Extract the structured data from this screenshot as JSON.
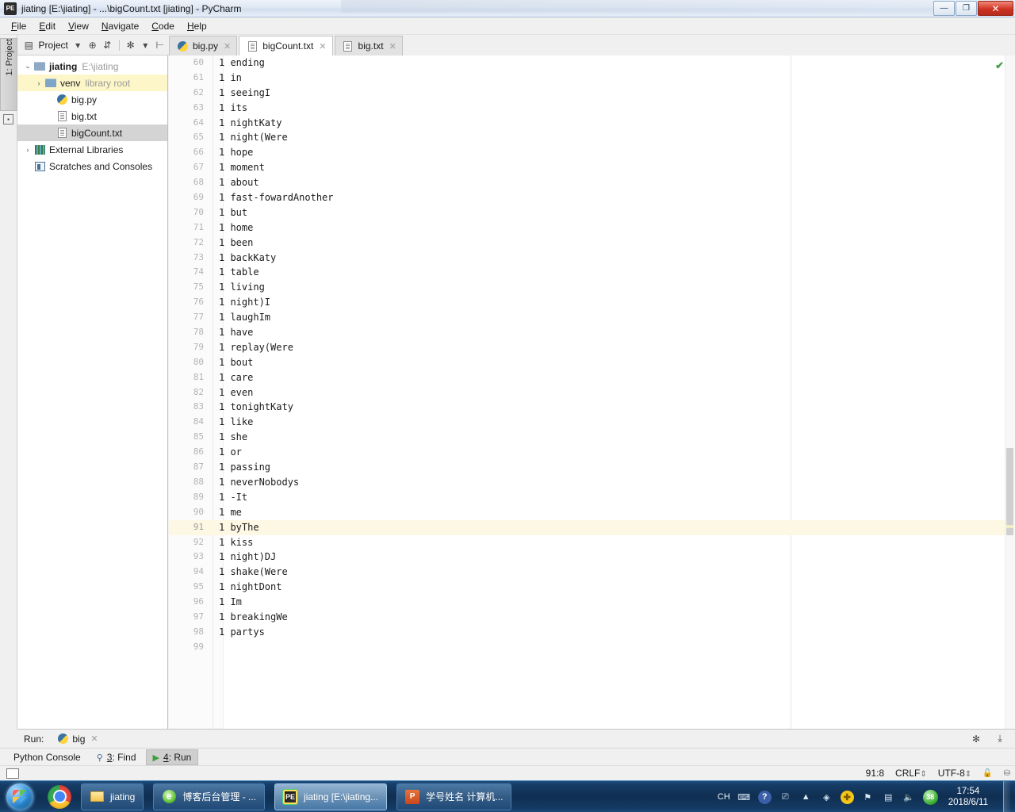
{
  "window": {
    "title": "jiating [E:\\jiating] - ...\\bigCount.txt [jiating] - PyCharm",
    "app_icon_label": "PE",
    "minimize_label": "—",
    "maximize_label": "❐",
    "close_label": "✕"
  },
  "menu": [
    {
      "label": "File"
    },
    {
      "label": "Edit"
    },
    {
      "label": "View"
    },
    {
      "label": "Navigate"
    },
    {
      "label": "Code"
    },
    {
      "label": "Help"
    }
  ],
  "toolbar": {
    "project_label": "Project",
    "dropdown_caret": "▾",
    "target_icon": "⊕",
    "collapse_icon": "⇵",
    "settings_icon": "✻",
    "settings_caret": "▾",
    "locate_icon": "⊢"
  },
  "left_strip": {
    "tab_label": "1: Project",
    "bottom_icon_label": "▪"
  },
  "project_tree": [
    {
      "depth": 0,
      "arrow": "⌄",
      "icon": "folder",
      "name": "jiating",
      "bold": true,
      "sub": "E:\\jiating",
      "state": "normal"
    },
    {
      "depth": 1,
      "arrow": "›",
      "icon": "folder-src",
      "name": "venv",
      "bold": false,
      "sub": "library root",
      "state": "highlight"
    },
    {
      "depth": 2,
      "arrow": "",
      "icon": "python",
      "name": "big.py",
      "bold": false,
      "sub": "",
      "state": "normal"
    },
    {
      "depth": 2,
      "arrow": "",
      "icon": "text",
      "name": "big.txt",
      "bold": false,
      "sub": "",
      "state": "normal"
    },
    {
      "depth": 2,
      "arrow": "",
      "icon": "text",
      "name": "bigCount.txt",
      "bold": false,
      "sub": "",
      "state": "selected"
    },
    {
      "depth": 0,
      "arrow": "›",
      "icon": "library",
      "name": "External Libraries",
      "bold": false,
      "sub": "",
      "state": "normal"
    },
    {
      "depth": 0,
      "arrow": "",
      "icon": "scratch",
      "name": "Scratches and Consoles",
      "bold": false,
      "sub": "",
      "state": "normal"
    }
  ],
  "editor_tabs": [
    {
      "label": "big.py",
      "icon": "python",
      "active": false,
      "close": "✕"
    },
    {
      "label": "bigCount.txt",
      "icon": "text",
      "active": true,
      "close": "✕"
    },
    {
      "label": "big.txt",
      "icon": "text",
      "active": false,
      "close": "✕"
    }
  ],
  "editor": {
    "inspection_ok_icon": "✔",
    "first_visible_line": 60,
    "current_line": 91,
    "lines": [
      {
        "n": 60,
        "text": "1 ending"
      },
      {
        "n": 61,
        "text": "1 in"
      },
      {
        "n": 62,
        "text": "1 seeingI"
      },
      {
        "n": 63,
        "text": "1 its"
      },
      {
        "n": 64,
        "text": "1 nightKaty"
      },
      {
        "n": 65,
        "text": "1 night(Were"
      },
      {
        "n": 66,
        "text": "1 hope"
      },
      {
        "n": 67,
        "text": "1 moment"
      },
      {
        "n": 68,
        "text": "1 about"
      },
      {
        "n": 69,
        "text": "1 fast-fowardAnother"
      },
      {
        "n": 70,
        "text": "1 but"
      },
      {
        "n": 71,
        "text": "1 home"
      },
      {
        "n": 72,
        "text": "1 been"
      },
      {
        "n": 73,
        "text": "1 backKaty"
      },
      {
        "n": 74,
        "text": "1 table"
      },
      {
        "n": 75,
        "text": "1 living"
      },
      {
        "n": 76,
        "text": "1 night)I"
      },
      {
        "n": 77,
        "text": "1 laughIm"
      },
      {
        "n": 78,
        "text": "1 have"
      },
      {
        "n": 79,
        "text": "1 replay(Were"
      },
      {
        "n": 80,
        "text": "1 bout"
      },
      {
        "n": 81,
        "text": "1 care"
      },
      {
        "n": 82,
        "text": "1 even"
      },
      {
        "n": 83,
        "text": "1 tonightKaty"
      },
      {
        "n": 84,
        "text": "1 like"
      },
      {
        "n": 85,
        "text": "1 she"
      },
      {
        "n": 86,
        "text": "1 or"
      },
      {
        "n": 87,
        "text": "1 passing"
      },
      {
        "n": 88,
        "text": "1 neverNobodys"
      },
      {
        "n": 89,
        "text": "1 -It"
      },
      {
        "n": 90,
        "text": "1 me"
      },
      {
        "n": 91,
        "text": "1 byThe"
      },
      {
        "n": 92,
        "text": "1 kiss"
      },
      {
        "n": 93,
        "text": "1 night)DJ"
      },
      {
        "n": 94,
        "text": "1 shake(Were"
      },
      {
        "n": 95,
        "text": "1 nightDont"
      },
      {
        "n": 96,
        "text": "1 Im"
      },
      {
        "n": 97,
        "text": "1 breakingWe"
      },
      {
        "n": 98,
        "text": "1 partys"
      },
      {
        "n": 99,
        "text": ""
      }
    ]
  },
  "run_window": {
    "label": "Run:",
    "tab_label": "big",
    "tab_close": "✕",
    "settings_icon": "✻",
    "settings_caret": "▾",
    "minimize_icon": "⤓"
  },
  "bottom_tool_tabs": [
    {
      "label": "Python Console",
      "icon": "python",
      "active": false
    },
    {
      "label": "3: Find",
      "icon": "search",
      "active": false
    },
    {
      "label": "4: Run",
      "icon": "play",
      "active": true
    }
  ],
  "status_bar": {
    "caret_position": "91:8",
    "line_separator": "CRLF",
    "line_separator_caret": "⇕",
    "encoding": "UTF-8",
    "encoding_caret": "⇕",
    "lock_icon": "🔒",
    "sync_icon": "⎈"
  },
  "taskbar": {
    "start_label": "Start",
    "pinned": [
      {
        "name": "chrome",
        "label": "Google Chrome"
      }
    ],
    "tasks": [
      {
        "label": "jiating",
        "icon": "folder",
        "active": false
      },
      {
        "label": "博客后台管理 - ...",
        "icon": "ie",
        "active": false
      },
      {
        "label": "jiating [E:\\jiating...",
        "icon": "pycharm",
        "active": true
      },
      {
        "label": "学号姓名 计算机...",
        "icon": "ppt",
        "active": false
      }
    ],
    "tray": {
      "input_method": "CH",
      "keyboard_icon": "⌨",
      "help_icon": "?",
      "network_icon": "⎚",
      "expand_icon": "▲",
      "shield_icon": "🛡",
      "plus_icon": "✚",
      "flag_icon": "⚑",
      "monitor_icon": "🖳",
      "volume_icon": "🔊",
      "badge_count": "38",
      "time": "17:54",
      "date": "2018/6/11"
    }
  }
}
